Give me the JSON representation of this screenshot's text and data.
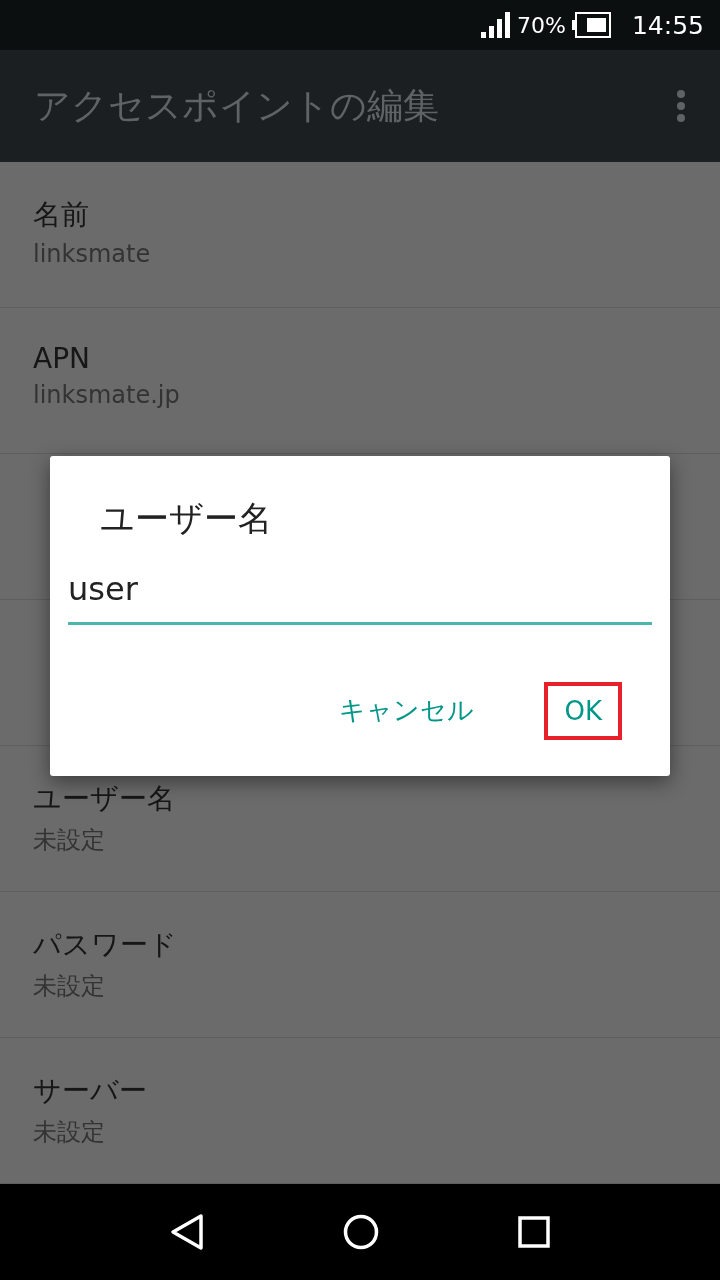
{
  "status_bar": {
    "signal_percent": "70%",
    "time": "14:55"
  },
  "app_bar": {
    "title": "アクセスポイントの編集"
  },
  "settings": [
    {
      "kind": "row",
      "label": "名前",
      "value": "linksmate"
    },
    {
      "kind": "row",
      "label": "APN",
      "value": "linksmate.jp"
    },
    {
      "kind": "covered"
    },
    {
      "kind": "covered"
    },
    {
      "kind": "row",
      "label": "ユーザー名",
      "value": "未設定"
    },
    {
      "kind": "row",
      "label": "パスワード",
      "value": "未設定"
    },
    {
      "kind": "row",
      "label": "サーバー",
      "value": "未設定"
    }
  ],
  "dialog": {
    "title": "ユーザー名",
    "input_value": "user",
    "buttons": [
      {
        "label": "キャンセル",
        "highlighted": false
      },
      {
        "label": "OK",
        "highlighted": true
      }
    ]
  }
}
